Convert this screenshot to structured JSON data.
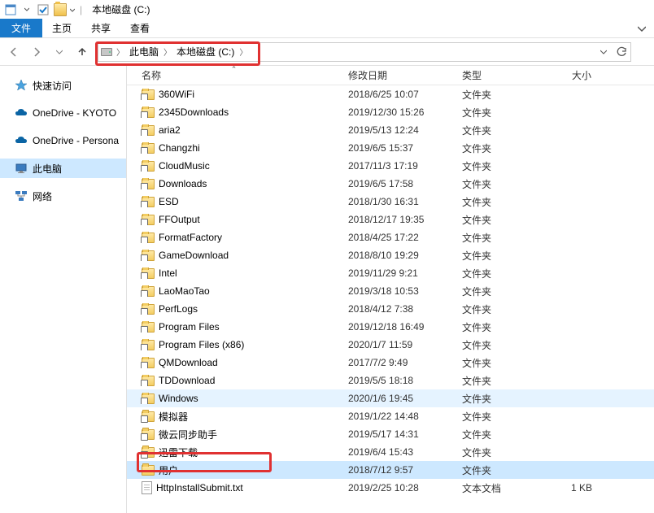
{
  "title": {
    "text": "本地磁盘 (C:)"
  },
  "menu": {
    "file": "文件",
    "home": "主页",
    "share": "共享",
    "view": "查看"
  },
  "breadcrumb": {
    "pc": "此电脑",
    "drive": "本地磁盘 (C:)"
  },
  "sidebar": {
    "quick": "快速访问",
    "onedrive1": "OneDrive - KYOTO",
    "onedrive2": "OneDrive - Persona",
    "thispc": "此电脑",
    "network": "网络"
  },
  "columns": {
    "name": "名称",
    "date": "修改日期",
    "type": "类型",
    "size": "大小"
  },
  "types": {
    "folder": "文件夹",
    "txt": "文本文档"
  },
  "files": [
    {
      "name": "360WiFi",
      "date": "2018/6/25 10:07",
      "kind": "folder",
      "size": "",
      "shortcut": true
    },
    {
      "name": "2345Downloads",
      "date": "2019/12/30 15:26",
      "kind": "folder",
      "size": "",
      "shortcut": true
    },
    {
      "name": "aria2",
      "date": "2019/5/13 12:24",
      "kind": "folder",
      "size": "",
      "shortcut": true
    },
    {
      "name": "Changzhi",
      "date": "2019/6/5 15:37",
      "kind": "folder",
      "size": "",
      "shortcut": true
    },
    {
      "name": "CloudMusic",
      "date": "2017/11/3 17:19",
      "kind": "folder",
      "size": "",
      "shortcut": true
    },
    {
      "name": "Downloads",
      "date": "2019/6/5 17:58",
      "kind": "folder",
      "size": "",
      "shortcut": true
    },
    {
      "name": "ESD",
      "date": "2018/1/30 16:31",
      "kind": "folder",
      "size": "",
      "shortcut": true
    },
    {
      "name": "FFOutput",
      "date": "2018/12/17 19:35",
      "kind": "folder",
      "size": "",
      "shortcut": true
    },
    {
      "name": "FormatFactory",
      "date": "2018/4/25 17:22",
      "kind": "folder",
      "size": "",
      "shortcut": true
    },
    {
      "name": "GameDownload",
      "date": "2018/8/10 19:29",
      "kind": "folder",
      "size": "",
      "shortcut": true
    },
    {
      "name": "Intel",
      "date": "2019/11/29 9:21",
      "kind": "folder",
      "size": "",
      "shortcut": true
    },
    {
      "name": "LaoMaoTao",
      "date": "2019/3/18 10:53",
      "kind": "folder",
      "size": "",
      "shortcut": true
    },
    {
      "name": "PerfLogs",
      "date": "2018/4/12 7:38",
      "kind": "folder",
      "size": "",
      "shortcut": true
    },
    {
      "name": "Program Files",
      "date": "2019/12/18 16:49",
      "kind": "folder",
      "size": "",
      "shortcut": true
    },
    {
      "name": "Program Files (x86)",
      "date": "2020/1/7 11:59",
      "kind": "folder",
      "size": "",
      "shortcut": true
    },
    {
      "name": "QMDownload",
      "date": "2017/7/2 9:49",
      "kind": "folder",
      "size": "",
      "shortcut": true
    },
    {
      "name": "TDDownload",
      "date": "2019/5/5 18:18",
      "kind": "folder",
      "size": "",
      "shortcut": true
    },
    {
      "name": "Windows",
      "date": "2020/1/6 19:45",
      "kind": "folder",
      "size": "",
      "shortcut": true,
      "hover": true
    },
    {
      "name": "模拟器",
      "date": "2019/1/22 14:48",
      "kind": "folder",
      "size": "",
      "shortcut": true
    },
    {
      "name": "微云同步助手",
      "date": "2019/5/17 14:31",
      "kind": "folder",
      "size": "",
      "shortcut": true
    },
    {
      "name": "迅雷下载",
      "date": "2019/6/4 15:43",
      "kind": "folder",
      "size": "",
      "shortcut": true
    },
    {
      "name": "用户",
      "date": "2018/7/12 9:57",
      "kind": "folder",
      "size": "",
      "selected": true
    },
    {
      "name": "HttpInstallSubmit.txt",
      "date": "2019/2/25 10:28",
      "kind": "txt",
      "size": "1 KB"
    }
  ]
}
